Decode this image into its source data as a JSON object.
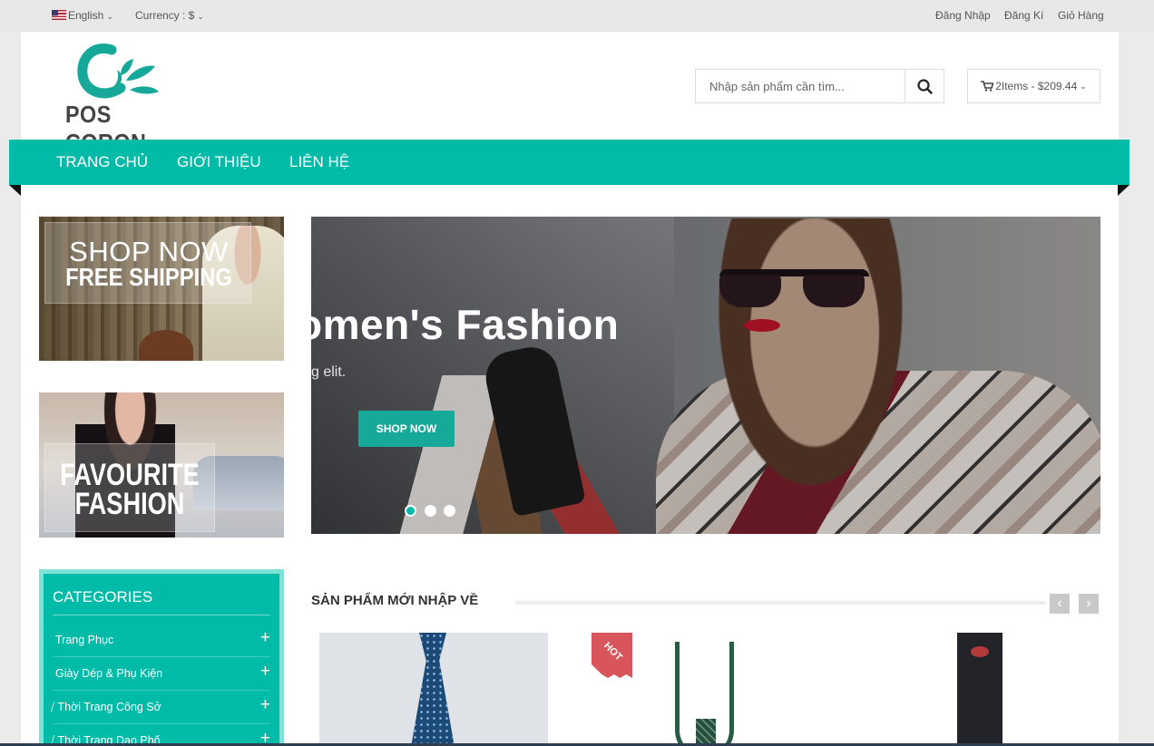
{
  "topbar": {
    "language": "English",
    "currency": "Currency : $",
    "login": "Đăng Nhập",
    "register": "Đăng Kí",
    "cart_link": "Giỏ Hàng"
  },
  "header": {
    "logo_text": "POS CORON",
    "search_placeholder": "Nhập sản phẩm cần tìm...",
    "cart_summary": "2Items - $209.44"
  },
  "nav": {
    "items": [
      "TRANG CHỦ",
      "GIỚI THIỆU",
      "LIÊN HỆ"
    ]
  },
  "banners": {
    "left_top": {
      "line1": "SHOP NOW",
      "line2": "FREE SHIPPING"
    },
    "left_bottom": {
      "line1": "FAVOURITE",
      "line2": "FASHION"
    }
  },
  "slider": {
    "title": "omen's Fashion",
    "subtitle": "g elit.",
    "button": "SHOP NOW",
    "slide_count": 3,
    "active_slide": 1
  },
  "categories": {
    "title": "CATEGORIES",
    "items": [
      "Trang Phục",
      "Giày Dép & Phụ Kiện",
      "⧸ Thời Trang Công Sở",
      "⧸ Thời Trang Dạo Phố"
    ]
  },
  "new_products": {
    "title": "SẢN PHẨM MỚI NHẬP VỀ",
    "badge": "HOT"
  },
  "colors": {
    "accent": "#00bba7",
    "hot_badge": "#d8555c"
  },
  "icons": [
    "chevron-down-icon",
    "flag-us-icon",
    "search-icon",
    "cart-icon",
    "plus-icon",
    "chevron-left-icon",
    "chevron-right-icon"
  ]
}
